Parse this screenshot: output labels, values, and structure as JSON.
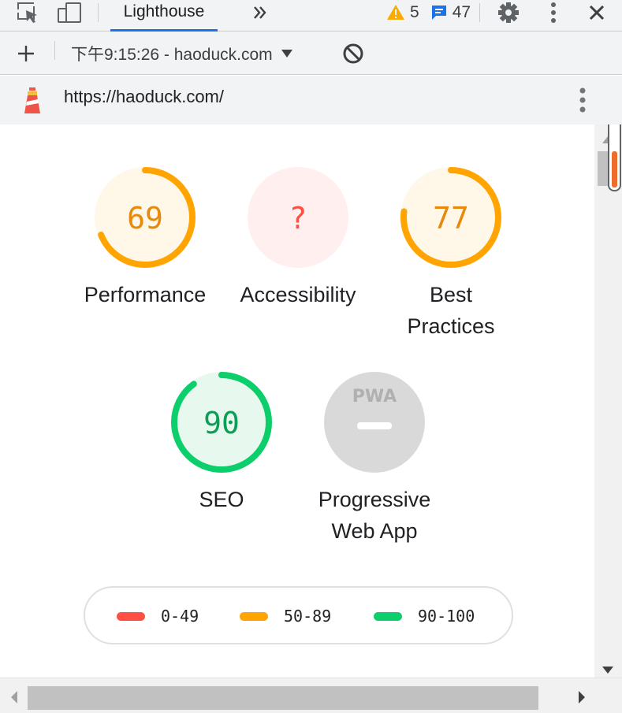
{
  "toolbar": {
    "tab_label": "Lighthouse",
    "warnings_count": "5",
    "messages_count": "47"
  },
  "report_bar": {
    "selected_report": "下午9:15:26 - haoduck.com"
  },
  "url_bar": {
    "url": "https://haoduck.com/"
  },
  "colors": {
    "fail": "#ff4e42",
    "average": "#ffa400",
    "pass": "#0cce6b",
    "na": "#d9d9d9"
  },
  "gauges": [
    {
      "label": "Performance",
      "score": "69",
      "value": 0.69,
      "status": "average"
    },
    {
      "label": "Accessibility",
      "score": "?",
      "value": 0,
      "status": "error"
    },
    {
      "label": "Best Practices",
      "score": "77",
      "value": 0.77,
      "status": "average"
    },
    {
      "label": "SEO",
      "score": "90",
      "value": 0.9,
      "status": "pass"
    },
    {
      "label": "Progressive Web App",
      "score": "PWA",
      "value": 0,
      "status": "pwa"
    }
  ],
  "legend": [
    {
      "range": "0-49",
      "status": "fail"
    },
    {
      "range": "50-89",
      "status": "average"
    },
    {
      "range": "90-100",
      "status": "pass"
    }
  ]
}
